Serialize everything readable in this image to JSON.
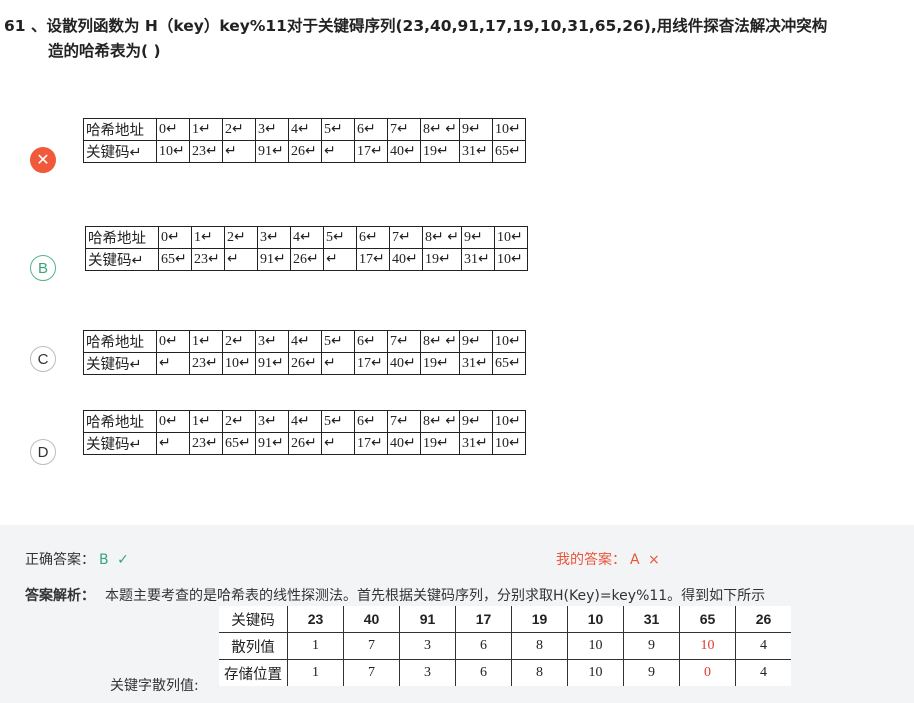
{
  "question": {
    "number": "61 、",
    "text_line1": "设散列函数为 H（key）key%11对于关键碍序列(23,40,91,17,19,10,31,65,26),用线件探杳法解决冲突构",
    "text_line2": "造的哈希表为( )"
  },
  "options": [
    {
      "badge": "✕",
      "state": "wrong",
      "addresses": [
        "哈希地址",
        "0↵",
        "1↵",
        "2↵",
        "3↵",
        "4↵",
        "5↵",
        "6↵",
        "7↵",
        "8↵ ↵",
        "9↵",
        "10↵"
      ],
      "keys": [
        "关键码↵",
        "10↵",
        "23↵",
        "↵",
        "91↵",
        "26↵",
        "↵",
        "17↵",
        "40↵",
        "19↵",
        "31↵",
        "65↵"
      ]
    },
    {
      "badge": "B",
      "state": "correct",
      "addresses": [
        "哈希地址",
        "0↵",
        "1↵",
        "2↵",
        "3↵",
        "4↵",
        "5↵",
        "6↵",
        "7↵",
        "8↵ ↵",
        "9↵",
        "10↵"
      ],
      "keys": [
        "关键码↵",
        "65↵",
        "23↵",
        "↵",
        "91↵",
        "26↵",
        "↵",
        "17↵",
        "40↵",
        "19↵",
        "31↵",
        "10↵"
      ]
    },
    {
      "badge": "C",
      "state": "normal",
      "addresses": [
        "哈希地址",
        "0↵",
        "1↵",
        "2↵",
        "3↵",
        "4↵",
        "5↵",
        "6↵",
        "7↵",
        "8↵ ↵",
        "9↵",
        "10↵"
      ],
      "keys": [
        "关键码↵",
        "↵",
        "23↵",
        "10↵",
        "91↵",
        "26↵",
        "↵",
        "17↵",
        "40↵",
        "19↵",
        "31↵",
        "65↵"
      ]
    },
    {
      "badge": "D",
      "state": "normal",
      "addresses": [
        "哈希地址",
        "0↵",
        "1↵",
        "2↵",
        "3↵",
        "4↵",
        "5↵",
        "6↵",
        "7↵",
        "8↵ ↵",
        "9↵",
        "10↵"
      ],
      "keys": [
        "关键码↵",
        "↵",
        "23↵",
        "65↵",
        "91↵",
        "26↵",
        "↵",
        "17↵",
        "40↵",
        "19↵",
        "31↵",
        "10↵"
      ]
    }
  ],
  "answer": {
    "correct_label": "正确答案：",
    "correct_value": "B",
    "correct_icon": "✓",
    "my_label": "我的答案：",
    "my_value": "A",
    "my_icon": "×",
    "explain_label": "答案解析：",
    "explain_text": "本题主要考查的是哈希表的线性探测法。首先根据关键码序列，分别求取H(Key)=key%11。得到如下所示",
    "hash_label": "关键字散列值:"
  },
  "result_table": {
    "rows": [
      [
        "关键码",
        "23",
        "40",
        "91",
        "17",
        "19",
        "10",
        "31",
        "65",
        "26"
      ],
      [
        "散列值",
        "1",
        "7",
        "3",
        "6",
        "8",
        "10",
        "9",
        "10",
        "4"
      ],
      [
        "存储位置",
        "1",
        "7",
        "3",
        "6",
        "8",
        "10",
        "9",
        "0",
        "4"
      ]
    ],
    "highlight_column": 8,
    "highlight_color": "#e53935"
  },
  "colors": {
    "wrong": "#f05a3a",
    "correct": "#3aa579",
    "panel_bg": "#f3f4f6"
  }
}
